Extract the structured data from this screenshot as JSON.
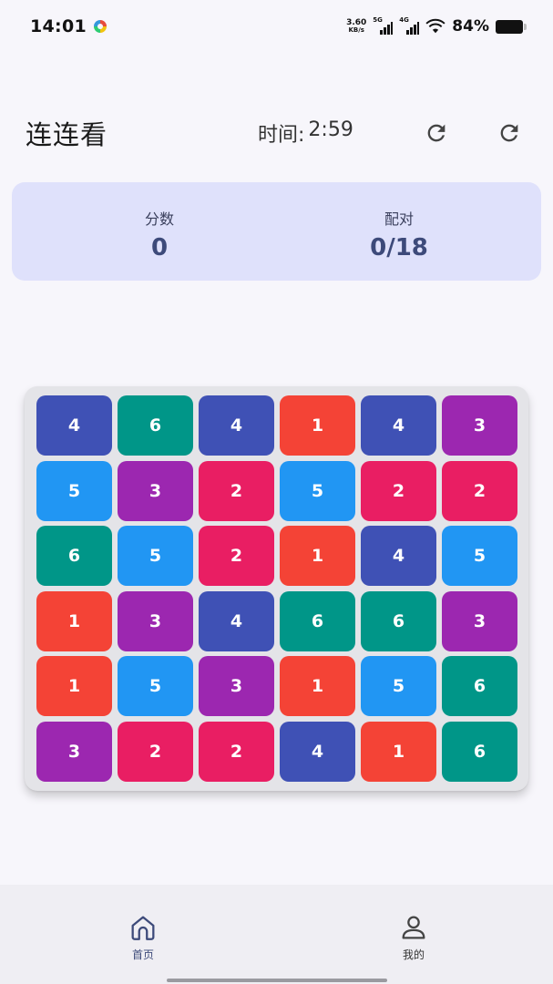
{
  "status_bar": {
    "time": "14:01",
    "net_speed_value": "3.60",
    "net_speed_unit": "KB/s",
    "signal_1_label": "5G",
    "signal_2_label": "4G",
    "battery_percent": "84%",
    "icons": [
      "app-icon",
      "signal-icon",
      "wifi-icon",
      "battery-icon"
    ]
  },
  "header": {
    "title": "连连看",
    "timer_label": "时间:",
    "timer_value": "2:59",
    "buttons": [
      "refresh-icon",
      "restart-icon"
    ]
  },
  "stats": {
    "score_label": "分数",
    "score_value": "0",
    "pairs_label": "配对",
    "pairs_value": "0/18"
  },
  "board": {
    "rows": 6,
    "cols": 6,
    "tiles": [
      [
        4,
        6,
        4,
        1,
        4,
        3
      ],
      [
        5,
        3,
        2,
        5,
        2,
        2
      ],
      [
        6,
        5,
        2,
        1,
        4,
        5
      ],
      [
        1,
        3,
        4,
        6,
        6,
        3
      ],
      [
        1,
        5,
        3,
        1,
        5,
        6
      ],
      [
        3,
        2,
        2,
        4,
        1,
        6
      ]
    ],
    "colors": {
      "1": "#f44336",
      "2": "#e91e63",
      "3": "#9c27b0",
      "4": "#3f51b5",
      "5": "#2196f3",
      "6": "#009688"
    }
  },
  "nav": {
    "home_label": "首页",
    "mine_label": "我的",
    "active": "home"
  }
}
